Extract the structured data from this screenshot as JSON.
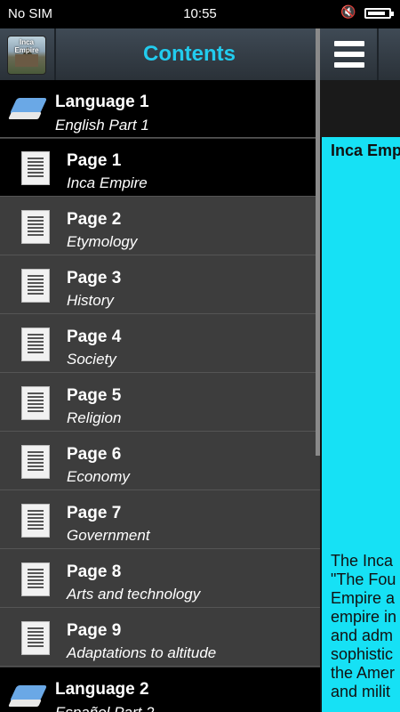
{
  "status_bar": {
    "carrier": "No SIM",
    "time": "10:55",
    "battery_fraction": 0.85,
    "icons": [
      "mute-icon",
      "battery-icon"
    ]
  },
  "drawer": {
    "title": "Contents",
    "app_icon_label": "Inca Empire",
    "items": [
      {
        "type": "language",
        "label": "Language 1",
        "sub": "English Part 1"
      },
      {
        "type": "page",
        "label": "Page 1",
        "sub": "Inca Empire",
        "selected": true
      },
      {
        "type": "page",
        "label": "Page 2",
        "sub": "Etymology"
      },
      {
        "type": "page",
        "label": "Page 3",
        "sub": "History"
      },
      {
        "type": "page",
        "label": "Page 4",
        "sub": "Society"
      },
      {
        "type": "page",
        "label": "Page 5",
        "sub": "Religion"
      },
      {
        "type": "page",
        "label": "Page 6",
        "sub": "Economy"
      },
      {
        "type": "page",
        "label": "Page 7",
        "sub": "Government"
      },
      {
        "type": "page",
        "label": "Page 8",
        "sub": "Arts and technology"
      },
      {
        "type": "page",
        "label": "Page 9",
        "sub": "Adaptations to altitude"
      },
      {
        "type": "language",
        "label": "Language 2",
        "sub": "Español Part 2"
      }
    ]
  },
  "content": {
    "article_title": "Inca Emp",
    "article_lines": [
      "The Inca",
      "\"The Fou",
      "Empire a",
      "empire in",
      "and adm",
      "sophistic",
      "the Amer",
      "and milit"
    ]
  },
  "colors": {
    "accent": "#22ccee",
    "article_bg": "#16e1f5",
    "drawer_bg": "#3d3d3d"
  }
}
